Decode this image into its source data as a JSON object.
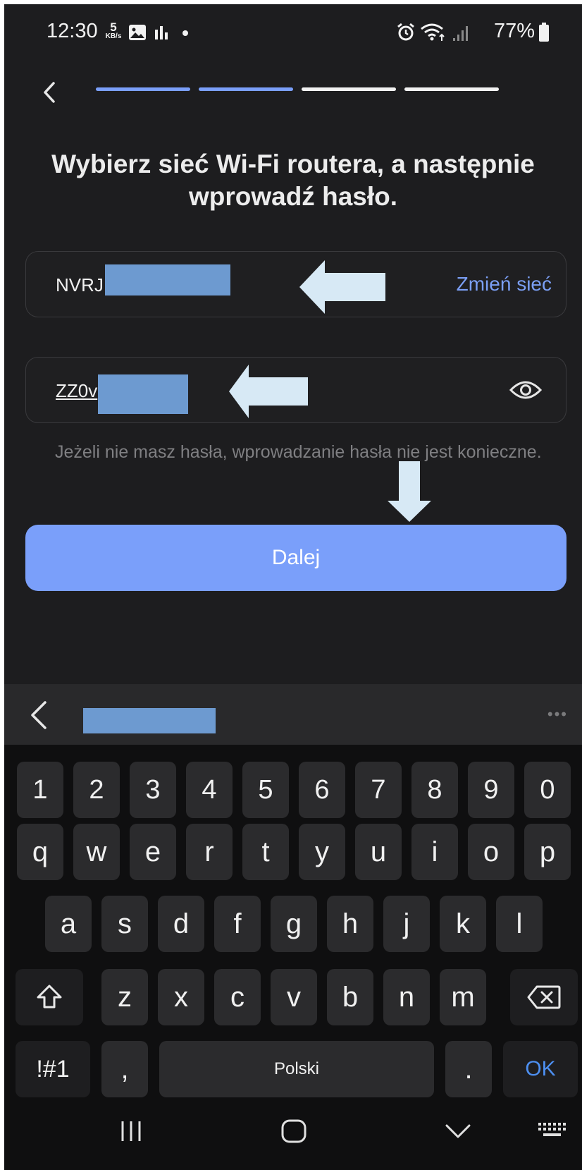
{
  "status_bar": {
    "time": "12:30",
    "speed_value": "5",
    "speed_unit": "KB/s",
    "battery_text": "77%",
    "icons": [
      "gallery-icon",
      "stats-icon",
      "dot-icon",
      "alarm-icon",
      "wifi-icon",
      "signal-icon",
      "battery-icon"
    ]
  },
  "header": {
    "progress_steps": [
      {
        "state": "done",
        "color": "#7a9ffa"
      },
      {
        "state": "done",
        "color": "#7a9ffa"
      },
      {
        "state": "pending",
        "color": "#f2f2f2"
      },
      {
        "state": "pending",
        "color": "#f2f2f2"
      }
    ]
  },
  "title_line1": "Wybierz sieć Wi-Fi routera, a następnie",
  "title_line2": "wprowadź hasło.",
  "network_field": {
    "ssid_visible": "NVRJ",
    "change_label": "Zmień sieć"
  },
  "password_field": {
    "value_visible": "ZZ0v"
  },
  "hint": "Jeżeli nie masz hasła, wprowadzanie hasła nie jest konieczne.",
  "next_button": "Dalej",
  "keyboard": {
    "more_label": "•••",
    "row_numbers": [
      "1",
      "2",
      "3",
      "4",
      "5",
      "6",
      "7",
      "8",
      "9",
      "0"
    ],
    "row1": [
      "q",
      "w",
      "e",
      "r",
      "t",
      "y",
      "u",
      "i",
      "o",
      "p"
    ],
    "row2": [
      "a",
      "s",
      "d",
      "f",
      "g",
      "h",
      "j",
      "k",
      "l"
    ],
    "row3": [
      "z",
      "x",
      "c",
      "v",
      "b",
      "n",
      "m"
    ],
    "sym_label": "!#1",
    "comma_label": ",",
    "space_label": "Polski",
    "period_label": ".",
    "ok_label": "OK"
  },
  "colors": {
    "accent": "#7a9ffa",
    "background": "#1d1d1f",
    "link": "#7b9ff5",
    "redaction": "#6d9ad0",
    "annotation_arrow": "#d7e9f5"
  }
}
